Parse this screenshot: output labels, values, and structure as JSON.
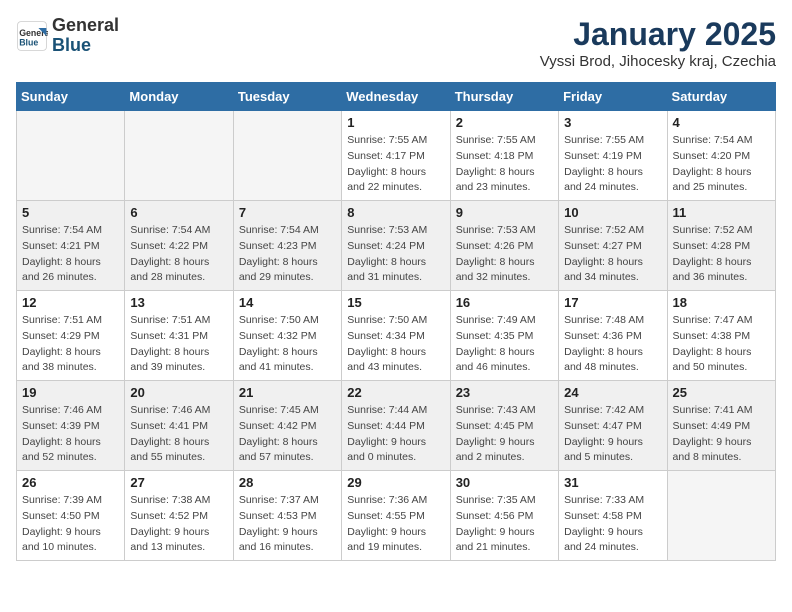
{
  "header": {
    "logo_general": "General",
    "logo_blue": "Blue",
    "month_title": "January 2025",
    "location": "Vyssi Brod, Jihocesky kraj, Czechia"
  },
  "days_of_week": [
    "Sunday",
    "Monday",
    "Tuesday",
    "Wednesday",
    "Thursday",
    "Friday",
    "Saturday"
  ],
  "weeks": [
    [
      {
        "day": "",
        "info": ""
      },
      {
        "day": "",
        "info": ""
      },
      {
        "day": "",
        "info": ""
      },
      {
        "day": "1",
        "info": "Sunrise: 7:55 AM\nSunset: 4:17 PM\nDaylight: 8 hours\nand 22 minutes."
      },
      {
        "day": "2",
        "info": "Sunrise: 7:55 AM\nSunset: 4:18 PM\nDaylight: 8 hours\nand 23 minutes."
      },
      {
        "day": "3",
        "info": "Sunrise: 7:55 AM\nSunset: 4:19 PM\nDaylight: 8 hours\nand 24 minutes."
      },
      {
        "day": "4",
        "info": "Sunrise: 7:54 AM\nSunset: 4:20 PM\nDaylight: 8 hours\nand 25 minutes."
      }
    ],
    [
      {
        "day": "5",
        "info": "Sunrise: 7:54 AM\nSunset: 4:21 PM\nDaylight: 8 hours\nand 26 minutes."
      },
      {
        "day": "6",
        "info": "Sunrise: 7:54 AM\nSunset: 4:22 PM\nDaylight: 8 hours\nand 28 minutes."
      },
      {
        "day": "7",
        "info": "Sunrise: 7:54 AM\nSunset: 4:23 PM\nDaylight: 8 hours\nand 29 minutes."
      },
      {
        "day": "8",
        "info": "Sunrise: 7:53 AM\nSunset: 4:24 PM\nDaylight: 8 hours\nand 31 minutes."
      },
      {
        "day": "9",
        "info": "Sunrise: 7:53 AM\nSunset: 4:26 PM\nDaylight: 8 hours\nand 32 minutes."
      },
      {
        "day": "10",
        "info": "Sunrise: 7:52 AM\nSunset: 4:27 PM\nDaylight: 8 hours\nand 34 minutes."
      },
      {
        "day": "11",
        "info": "Sunrise: 7:52 AM\nSunset: 4:28 PM\nDaylight: 8 hours\nand 36 minutes."
      }
    ],
    [
      {
        "day": "12",
        "info": "Sunrise: 7:51 AM\nSunset: 4:29 PM\nDaylight: 8 hours\nand 38 minutes."
      },
      {
        "day": "13",
        "info": "Sunrise: 7:51 AM\nSunset: 4:31 PM\nDaylight: 8 hours\nand 39 minutes."
      },
      {
        "day": "14",
        "info": "Sunrise: 7:50 AM\nSunset: 4:32 PM\nDaylight: 8 hours\nand 41 minutes."
      },
      {
        "day": "15",
        "info": "Sunrise: 7:50 AM\nSunset: 4:34 PM\nDaylight: 8 hours\nand 43 minutes."
      },
      {
        "day": "16",
        "info": "Sunrise: 7:49 AM\nSunset: 4:35 PM\nDaylight: 8 hours\nand 46 minutes."
      },
      {
        "day": "17",
        "info": "Sunrise: 7:48 AM\nSunset: 4:36 PM\nDaylight: 8 hours\nand 48 minutes."
      },
      {
        "day": "18",
        "info": "Sunrise: 7:47 AM\nSunset: 4:38 PM\nDaylight: 8 hours\nand 50 minutes."
      }
    ],
    [
      {
        "day": "19",
        "info": "Sunrise: 7:46 AM\nSunset: 4:39 PM\nDaylight: 8 hours\nand 52 minutes."
      },
      {
        "day": "20",
        "info": "Sunrise: 7:46 AM\nSunset: 4:41 PM\nDaylight: 8 hours\nand 55 minutes."
      },
      {
        "day": "21",
        "info": "Sunrise: 7:45 AM\nSunset: 4:42 PM\nDaylight: 8 hours\nand 57 minutes."
      },
      {
        "day": "22",
        "info": "Sunrise: 7:44 AM\nSunset: 4:44 PM\nDaylight: 9 hours\nand 0 minutes."
      },
      {
        "day": "23",
        "info": "Sunrise: 7:43 AM\nSunset: 4:45 PM\nDaylight: 9 hours\nand 2 minutes."
      },
      {
        "day": "24",
        "info": "Sunrise: 7:42 AM\nSunset: 4:47 PM\nDaylight: 9 hours\nand 5 minutes."
      },
      {
        "day": "25",
        "info": "Sunrise: 7:41 AM\nSunset: 4:49 PM\nDaylight: 9 hours\nand 8 minutes."
      }
    ],
    [
      {
        "day": "26",
        "info": "Sunrise: 7:39 AM\nSunset: 4:50 PM\nDaylight: 9 hours\nand 10 minutes."
      },
      {
        "day": "27",
        "info": "Sunrise: 7:38 AM\nSunset: 4:52 PM\nDaylight: 9 hours\nand 13 minutes."
      },
      {
        "day": "28",
        "info": "Sunrise: 7:37 AM\nSunset: 4:53 PM\nDaylight: 9 hours\nand 16 minutes."
      },
      {
        "day": "29",
        "info": "Sunrise: 7:36 AM\nSunset: 4:55 PM\nDaylight: 9 hours\nand 19 minutes."
      },
      {
        "day": "30",
        "info": "Sunrise: 7:35 AM\nSunset: 4:56 PM\nDaylight: 9 hours\nand 21 minutes."
      },
      {
        "day": "31",
        "info": "Sunrise: 7:33 AM\nSunset: 4:58 PM\nDaylight: 9 hours\nand 24 minutes."
      },
      {
        "day": "",
        "info": ""
      }
    ]
  ]
}
